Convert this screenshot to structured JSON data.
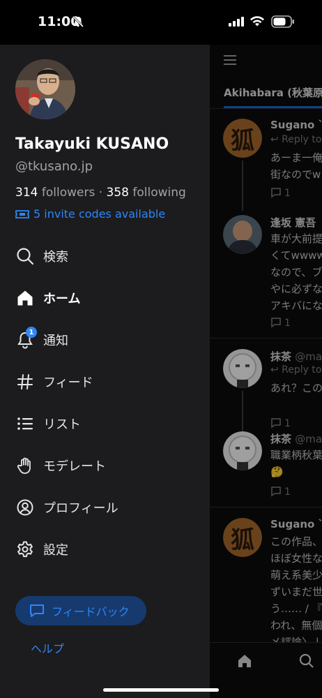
{
  "status_bar": {
    "time": "11:00"
  },
  "drawer": {
    "display_name": "Takayuki KUSANO",
    "handle": "@tkusano.jp",
    "followers_count": "314",
    "followers_label": "followers",
    "separator": " · ",
    "following_count": "358",
    "following_label": "following",
    "invite_text": "5 invite codes available",
    "nav": [
      {
        "label": "検索",
        "icon": "search-icon"
      },
      {
        "label": "ホーム",
        "icon": "home-icon"
      },
      {
        "label": "通知",
        "icon": "bell-icon",
        "badge": "1"
      },
      {
        "label": "フィード",
        "icon": "hash-icon"
      },
      {
        "label": "リスト",
        "icon": "list-icon"
      },
      {
        "label": "モデレート",
        "icon": "hand-icon"
      },
      {
        "label": "プロフィール",
        "icon": "user-circle-icon"
      },
      {
        "label": "設定",
        "icon": "gear-icon"
      }
    ],
    "feedback_label": "フィードバック",
    "help_label": "ヘルプ"
  },
  "feed": {
    "tab_label": "Akihabara (秋葉原",
    "posts": [
      {
        "name": "Sugano `",
        "reply": "↩ Reply to",
        "text": "あーま一俺\n街なのでw",
        "replies": "1"
      },
      {
        "name": "逢坂 憲吾",
        "text": "車が大前提\nくてwwww\nなので、ブ\nやに必ずな\nアキバにな",
        "replies": "1"
      },
      {
        "name": "抹茶",
        "handle": "@ma",
        "reply": "↩ Reply to",
        "text": "あれ？この",
        "replies": "1"
      },
      {
        "name": "抹茶",
        "handle": "@ma",
        "text": "職業柄秋葉\n🤔",
        "replies": "1"
      },
      {
        "name": "Sugano `",
        "text": "この作品、\nほぼ女性な\n萌え系美少\nずいまだ世\nう…… / 『\nわれ、無個\nメ評論〉 |"
      }
    ]
  },
  "colors": {
    "accent": "#2f86f5",
    "drawer_bg": "#1c1c1e"
  }
}
